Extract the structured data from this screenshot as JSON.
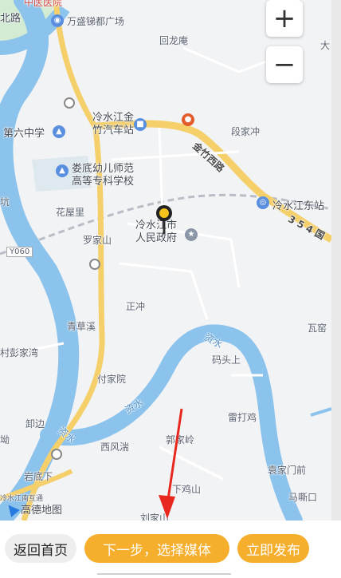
{
  "map": {
    "labels": {
      "hospital": "中医医院",
      "beilu": "北路",
      "wansheng": "万盛锑都广场",
      "huilong": "回龙庵",
      "da": "大",
      "school6": "第六中学",
      "busstation": "冷水江金\n竹汽车站",
      "duanjiachong": "段家冲",
      "jinzhu_road": "金竹西路",
      "loudi_school": "娄底幼儿师范\n高等专科学校",
      "keng": "坑",
      "huawuli": "花屋里",
      "east_station": "冷水江东站",
      "road354": "3 5 4 国",
      "gov": "冷水江市\n人民政府",
      "luojiashan": "罗家山",
      "y060": "Y060",
      "zhengchong": "正冲",
      "qingcaoxi": "青草溪",
      "waku": "瓦窑",
      "pengjiawan": "村彭家湾",
      "zishui1": "资水",
      "matoushang": "码头上",
      "fujiayuan": "付家院",
      "zishui2": "资水",
      "leidaji": "雷打鸡",
      "xiebian": "卸边",
      "ao": "坳",
      "zishui3": "资水",
      "xifengchuan": "西风湍",
      "guojialing": "郭家岭",
      "yuanjiamenqian": "袁家门前",
      "yandixia": "岩底下",
      "xiajishan": "下鸡山",
      "mashikou": "马嘶口",
      "liujiashan": "刘家山",
      "interchange": "冷水江南互通"
    },
    "logo_text": "高德地图",
    "zoom_in": "+",
    "zoom_out": "−",
    "colors": {
      "water": "#8cc3ec",
      "road": "#f7d97a",
      "land": "#f2f3f5",
      "green": "#cfe8cf"
    }
  },
  "toolbar": {
    "home_label": "返回首页",
    "next_label": "下一步，选择媒体",
    "publish_label": "立即发布"
  }
}
